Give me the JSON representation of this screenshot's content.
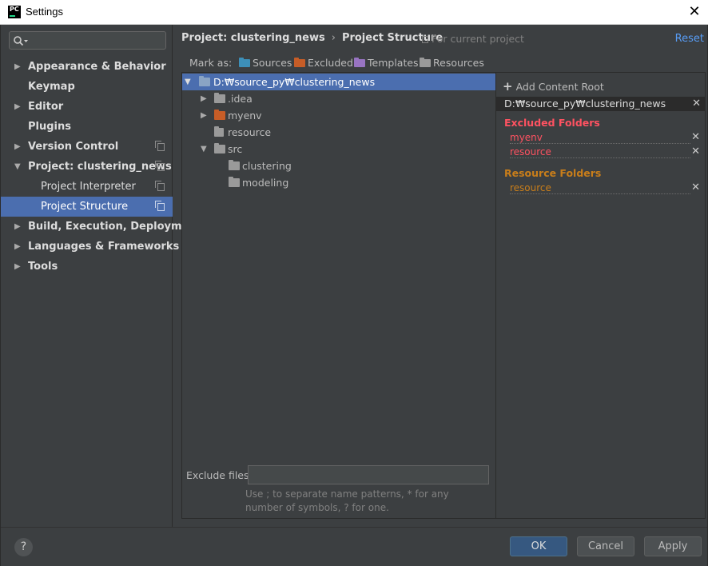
{
  "window": {
    "title": "Settings",
    "app_icon_text": "PC"
  },
  "search": {
    "placeholder": ""
  },
  "sidebar": {
    "items": [
      {
        "label": "Appearance & Behavior"
      },
      {
        "label": "Keymap"
      },
      {
        "label": "Editor"
      },
      {
        "label": "Plugins"
      },
      {
        "label": "Version Control"
      },
      {
        "label": "Project: clustering_news"
      },
      {
        "label": "Project Interpreter"
      },
      {
        "label": "Project Structure"
      },
      {
        "label": "Build, Execution, Deployment"
      },
      {
        "label": "Languages & Frameworks"
      },
      {
        "label": "Tools"
      }
    ]
  },
  "header": {
    "breadcrumb_project": "Project: clustering_news",
    "breadcrumb_separator": "›",
    "breadcrumb_page": "Project Structure",
    "for_current_project": "For current project",
    "reset": "Reset"
  },
  "mark_as": {
    "label": "Mark as:",
    "buttons": [
      {
        "label": "Sources",
        "color": "#3d8fb8"
      },
      {
        "label": "Excluded",
        "color": "#c75d27"
      },
      {
        "label": "Templates",
        "color": "#9874c2"
      },
      {
        "label": "Resources",
        "color": "#9a9a9a"
      }
    ]
  },
  "tree": {
    "root": "D:₩source_py₩clustering_news",
    "nodes": [
      {
        "label": ".idea"
      },
      {
        "label": "myenv"
      },
      {
        "label": "resource"
      },
      {
        "label": "src"
      },
      {
        "label": "clustering"
      },
      {
        "label": "modeling"
      }
    ]
  },
  "exclude_files": {
    "label": "Exclude files:",
    "value": "",
    "hint": "Use ; to separate name patterns, * for any number of symbols, ? for one."
  },
  "content_roots": {
    "add_label": "Add Content Root",
    "root_path": "D:₩source_py₩clustering_news",
    "excluded": {
      "title": "Excluded Folders",
      "color": "#ff5261",
      "items": [
        {
          "label": "myenv"
        },
        {
          "label": "resource"
        }
      ]
    },
    "resources": {
      "title": "Resource Folders",
      "color": "#c97e1a",
      "items": [
        {
          "label": "resource"
        }
      ]
    },
    "remove_glyph": "✕"
  },
  "buttons": {
    "help": "?",
    "ok": "OK",
    "cancel": "Cancel",
    "apply": "Apply"
  }
}
